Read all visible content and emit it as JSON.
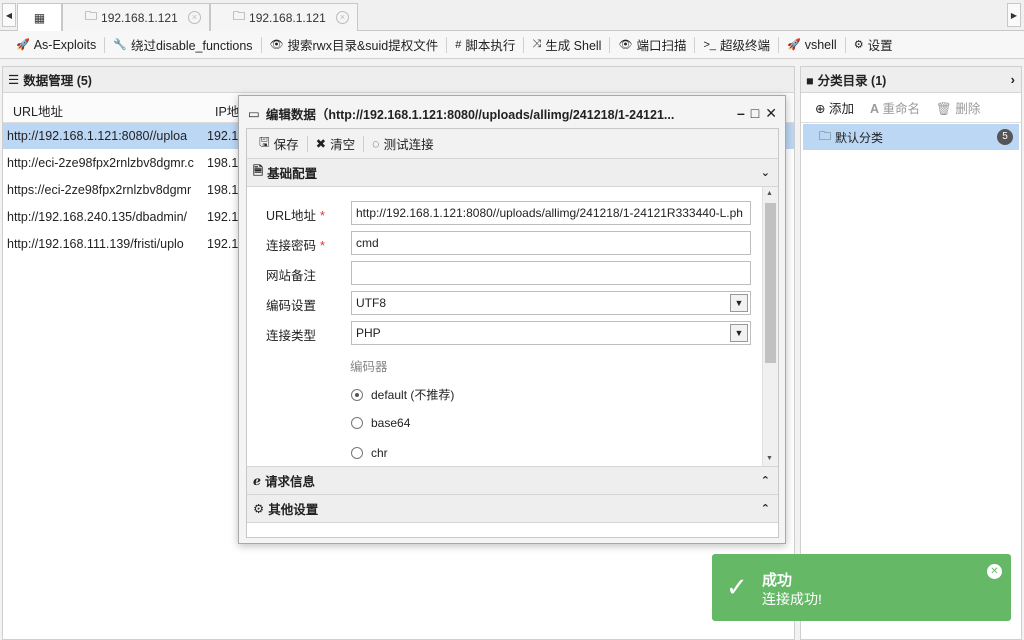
{
  "tabs": [
    {
      "label": "192.168.1.121"
    },
    {
      "label": "192.168.1.121"
    }
  ],
  "toolbar": [
    {
      "icon": "rocket-icon",
      "glyph": "🚀",
      "label": "As-Exploits"
    },
    {
      "icon": "wrench-icon",
      "glyph": "🔧",
      "label": "绕过disable_functions"
    },
    {
      "icon": "eye-icon",
      "glyph": "👁",
      "label": "搜索rwx目录&suid提权文件"
    },
    {
      "icon": "hash-icon",
      "glyph": "#",
      "label": "脚本执行"
    },
    {
      "icon": "shuffle-icon",
      "glyph": "⤨",
      "label": "生成 Shell"
    },
    {
      "icon": "eye-icon",
      "glyph": "👁",
      "label": "端口扫描"
    },
    {
      "icon": "terminal-icon",
      "glyph": ">_",
      "label": "超级终端"
    },
    {
      "icon": "rocket-icon",
      "glyph": "🚀",
      "label": "vshell"
    },
    {
      "icon": "gear-icon",
      "glyph": "⚙",
      "label": "设置"
    }
  ],
  "data_panel": {
    "title": "数据管理 (5)",
    "columns": [
      "URL地址",
      "IP地"
    ],
    "rows": [
      {
        "url": "http://192.168.1.121:8080//uploa",
        "ip": "192.1"
      },
      {
        "url": "http://eci-2ze98fpx2rnlzbv8dgmr.c",
        "ip": "198.1"
      },
      {
        "url": "https://eci-2ze98fpx2rnlzbv8dgmr",
        "ip": "198.1"
      },
      {
        "url": "http://192.168.240.135/dbadmin/",
        "ip": "192.1"
      },
      {
        "url": "http://192.168.111.139/fristi/uplo",
        "ip": "192.1"
      }
    ]
  },
  "category_panel": {
    "title": "分类目录 (1)",
    "add_label": "添加",
    "rename_label": "重命名",
    "delete_label": "删除",
    "items": [
      {
        "label": "默认分类",
        "count": "5"
      }
    ]
  },
  "dialog": {
    "title": "编辑数据（http://192.168.1.121:8080//uploads/allimg/241218/1-24121...",
    "save_label": "保存",
    "clear_label": "清空",
    "test_label": "测试连接",
    "section_basic": "基础配置",
    "section_request": "请求信息",
    "section_other": "其他设置",
    "fields": {
      "url_label": "URL地址",
      "url_value": "http://192.168.1.121:8080//uploads/allimg/241218/1-24121R333440-L.ph",
      "password_label": "连接密码",
      "password_value": "cmd",
      "note_label": "网站备注",
      "note_value": "",
      "encoding_label": "编码设置",
      "encoding_value": "UTF8",
      "type_label": "连接类型",
      "type_value": "PHP",
      "encoder_label": "编码器",
      "encoders": [
        "default (不推荐)",
        "base64",
        "chr"
      ],
      "required_mark": "*"
    }
  },
  "toast": {
    "title": "成功",
    "message": "连接成功!"
  }
}
